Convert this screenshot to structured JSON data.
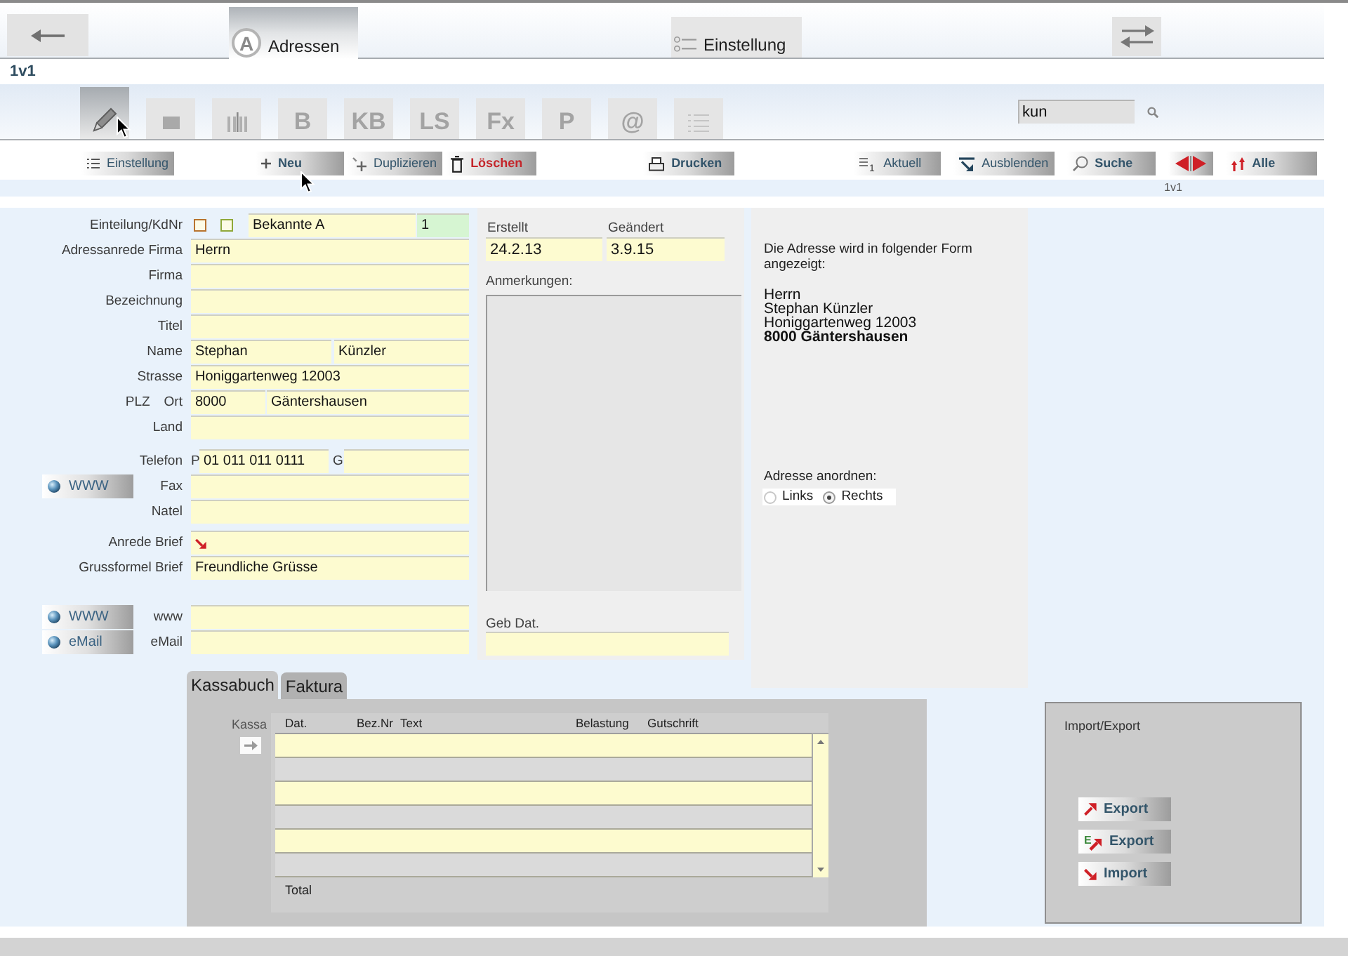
{
  "nav_tabs": [
    {
      "label": "Adressen",
      "badge": "A",
      "selected": true
    },
    {
      "label": "Einstellung",
      "selected": false
    }
  ],
  "record_title": "1v1",
  "layout_tabs": [
    {
      "kind": "pencil",
      "selected": true
    },
    {
      "kind": "square",
      "selected": false
    },
    {
      "kind": "columns",
      "selected": false
    },
    {
      "kind": "text",
      "label": "B",
      "selected": false
    },
    {
      "kind": "text",
      "label": "KB",
      "selected": false
    },
    {
      "kind": "text",
      "label": "LS",
      "selected": false
    },
    {
      "kind": "text",
      "label": "Fx",
      "selected": false
    },
    {
      "kind": "text",
      "label": "P",
      "selected": false
    },
    {
      "kind": "text",
      "label": "@",
      "selected": false
    },
    {
      "kind": "list",
      "selected": false
    }
  ],
  "search": {
    "value": "kun"
  },
  "action_groups": [
    [
      {
        "kind": "settings",
        "label": "Einstellung",
        "bold": false
      }
    ],
    [
      {
        "kind": "new",
        "label": "Neu",
        "bold": true
      },
      {
        "kind": "duplicate",
        "label": "Duplizieren",
        "bold": false
      },
      {
        "kind": "delete",
        "label": "Löschen",
        "bold": true
      }
    ],
    [
      {
        "kind": "print",
        "label": "Drucken",
        "bold": true
      }
    ],
    [
      {
        "kind": "current",
        "label": "Aktuell",
        "badge": "1",
        "bold": false
      },
      {
        "kind": "hide",
        "label": "Ausblenden",
        "bold": false
      },
      {
        "kind": "find",
        "label": "Suche",
        "bold": true
      },
      {
        "kind": "browse"
      },
      {
        "kind": "all",
        "label": "Alle",
        "bold": true
      }
    ]
  ],
  "record_counter": "1v1",
  "form": {
    "groups": [
      [
        {
          "kind": "category",
          "label": "Einteilung/KdNr",
          "checks": [
            {
              "checked": false,
              "color": "#b8732e"
            },
            {
              "checked": false,
              "color": "#8fa83a"
            }
          ],
          "values": [
            "Bekannte A",
            "1"
          ]
        },
        {
          "kind": "single",
          "label": "Adressanrede Firma",
          "value": "Herrn"
        },
        {
          "kind": "single",
          "label": "Firma"
        },
        {
          "kind": "single",
          "label": "Bezeichnung"
        },
        {
          "kind": "single",
          "label": "Titel"
        },
        {
          "kind": "split",
          "label": "Name",
          "values": [
            "Stephan",
            "Künzler"
          ]
        },
        {
          "kind": "single",
          "label": "Strasse",
          "value": "Honiggartenweg 12003"
        },
        {
          "kind": "city",
          "labels": [
            "PLZ",
            "Ort"
          ],
          "values": [
            "8000",
            "Gäntershausen"
          ]
        },
        {
          "kind": "single",
          "label": "Land"
        }
      ],
      [
        {
          "kind": "phone",
          "label": "Telefon",
          "parts": [
            {
              "prefix": "P",
              "value": "01 011 011 0111"
            },
            {
              "prefix": "G"
            }
          ]
        },
        {
          "kind": "single",
          "label": "Fax",
          "button": "WWW"
        },
        {
          "kind": "single",
          "label": "Natel"
        }
      ],
      [
        {
          "kind": "single",
          "label": "Anrede Brief",
          "menu": true
        },
        {
          "kind": "single",
          "label": "Grussformel Brief",
          "value": "Freundliche Grüsse"
        }
      ],
      [
        {
          "kind": "single",
          "label": "www",
          "button": "WWW"
        },
        {
          "kind": "single",
          "label": "eMail",
          "button": "eMail"
        }
      ]
    ]
  },
  "record_info": {
    "created": {
      "label": "Erstellt",
      "value": "24.2.13"
    },
    "modified": {
      "label": "Geändert",
      "value": "3.9.15"
    },
    "notes": {
      "label": "Anmerkungen:"
    },
    "birthday": {
      "label": "Geb Dat."
    }
  },
  "preview": {
    "intro": "Die Adresse wird in folgender Form angezeigt:",
    "lines": [
      {
        "text": "Herrn",
        "bold": false
      },
      {
        "text": "Stephan Künzler",
        "bold": false
      },
      {
        "text": "Honiggartenweg 12003",
        "bold": false
      },
      {
        "text": "8000 Gäntershausen",
        "bold": true
      }
    ],
    "alignment": {
      "label": "Adresse anordnen:",
      "options": [
        {
          "label": "Links",
          "selected": false
        },
        {
          "label": "Rechts",
          "selected": true
        }
      ]
    }
  },
  "ledger": {
    "tabs": [
      {
        "label": "Kassabuch",
        "selected": true
      },
      {
        "label": "Faktura",
        "selected": false
      }
    ],
    "side_label": "Kassa",
    "columns": [
      "Dat.",
      "Bez.Nr",
      "Text",
      "Belastung",
      "Gutschrift"
    ],
    "total_label": "Total"
  },
  "import_export": {
    "title": "Import/Export",
    "buttons": [
      {
        "kind": "export",
        "label": "Export"
      },
      {
        "kind": "export",
        "badge": "E",
        "label": "Export"
      },
      {
        "kind": "import",
        "label": "Import"
      }
    ]
  }
}
